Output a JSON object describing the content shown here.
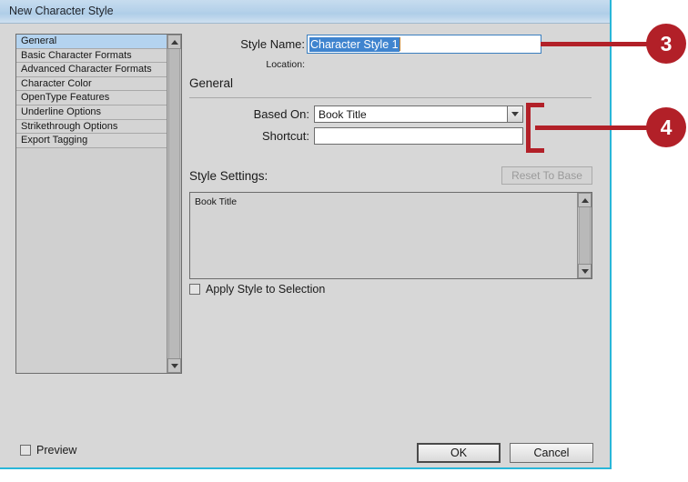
{
  "window": {
    "title": "New Character Style"
  },
  "categories": [
    {
      "label": "General",
      "selected": true
    },
    {
      "label": "Basic Character Formats",
      "selected": false
    },
    {
      "label": "Advanced Character Formats",
      "selected": false
    },
    {
      "label": "Character Color",
      "selected": false
    },
    {
      "label": "OpenType Features",
      "selected": false
    },
    {
      "label": "Underline Options",
      "selected": false
    },
    {
      "label": "Strikethrough Options",
      "selected": false
    },
    {
      "label": "Export Tagging",
      "selected": false
    }
  ],
  "form": {
    "style_name_label": "Style Name:",
    "style_name_value": "Character Style 1",
    "location_label": "Location:",
    "location_value": "",
    "section_header": "General",
    "based_on_label": "Based On:",
    "based_on_value": "Book Title",
    "shortcut_label": "Shortcut:",
    "shortcut_value": "",
    "style_settings_label": "Style Settings:",
    "reset_to_base_label": "Reset To Base",
    "style_settings_text": "Book Title",
    "apply_style_label": "Apply Style to Selection"
  },
  "footer": {
    "preview_label": "Preview",
    "ok_label": "OK",
    "cancel_label": "Cancel"
  },
  "callouts": [
    {
      "number": "3"
    },
    {
      "number": "4"
    }
  ],
  "colors": {
    "callout_red": "#b22028",
    "selection_blue": "#3f84cf",
    "titlebar_blue": "#b6d2ea",
    "dialog_border": "#29b6d8"
  }
}
